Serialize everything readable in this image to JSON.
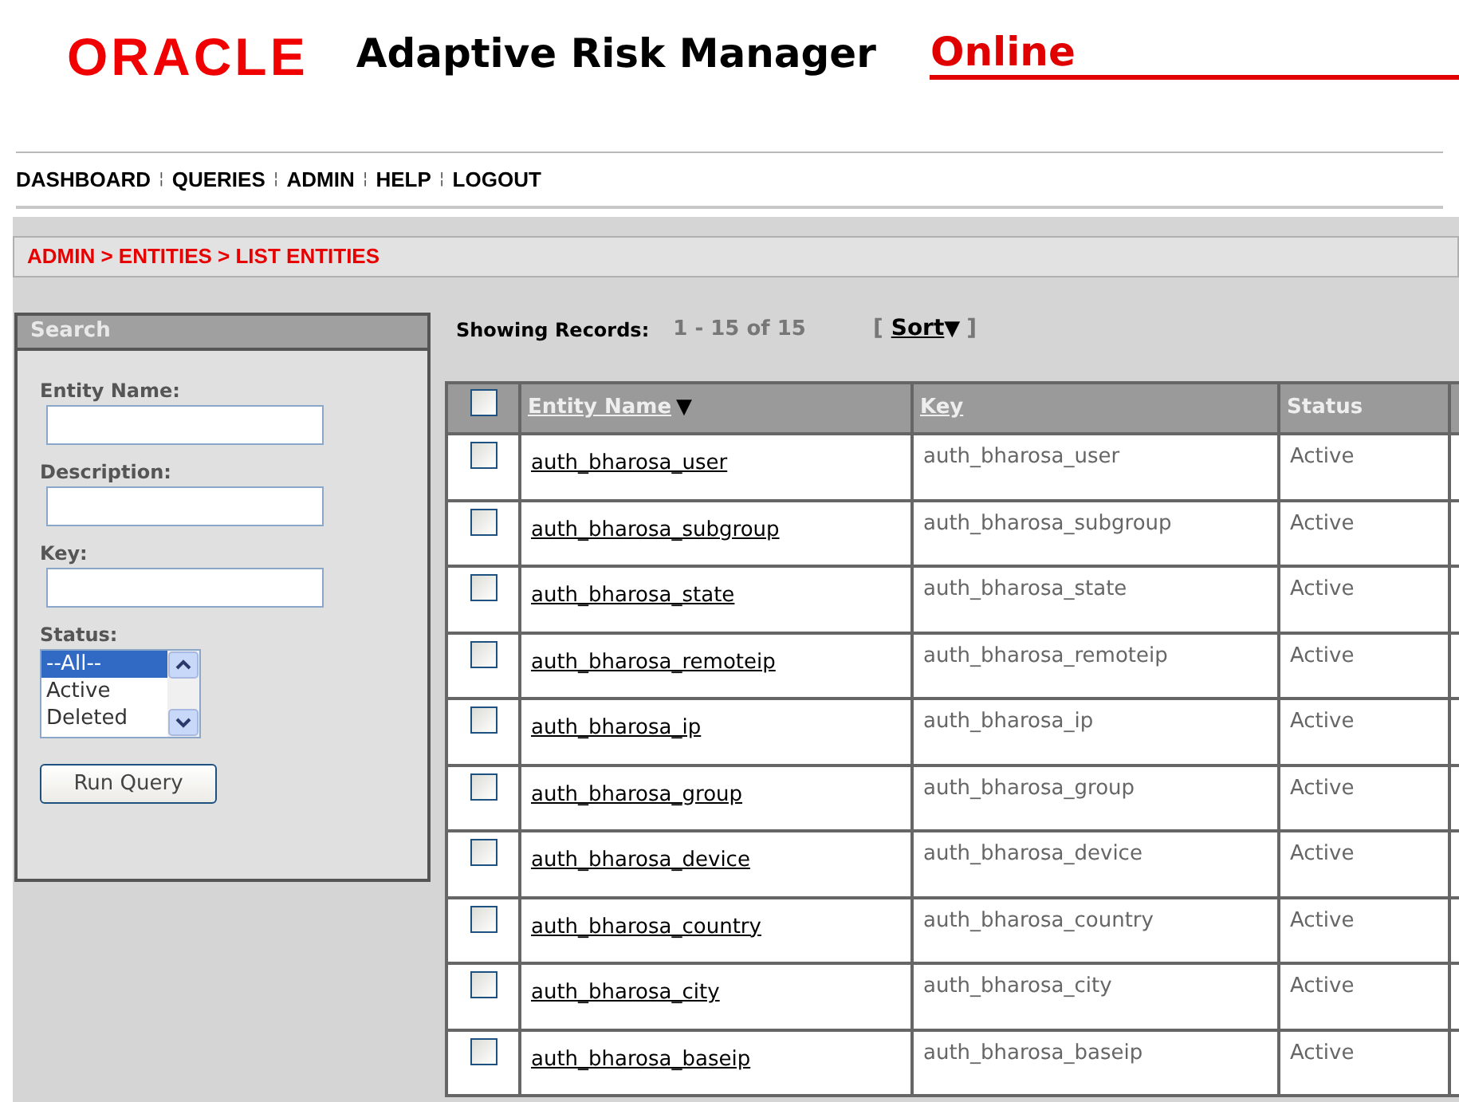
{
  "header": {
    "logo": "ORACLE",
    "product": "Adaptive Risk Manager",
    "edition": "Online"
  },
  "nav": [
    {
      "label": "DASHBOARD"
    },
    {
      "label": "QUERIES"
    },
    {
      "label": "ADMIN"
    },
    {
      "label": "HELP"
    },
    {
      "label": "LOGOUT"
    }
  ],
  "nav_separator": "¦",
  "breadcrumb": "ADMIN > ENTITIES > LIST ENTITIES",
  "search": {
    "title": "Search",
    "fields": [
      {
        "label": "Entity Name:"
      },
      {
        "label": "Description:"
      },
      {
        "label": "Key:"
      }
    ],
    "status_label": "Status:",
    "status_options": [
      {
        "label": "--All--",
        "selected": true
      },
      {
        "label": "Active",
        "selected": false
      },
      {
        "label": "Deleted",
        "selected": false
      }
    ],
    "run_button": "Run Query"
  },
  "records": {
    "label": "Showing Records:",
    "range": "1 - 15 of 15",
    "sort_open": "[",
    "sort": "Sort",
    "sort_arrow": "▼",
    "sort_close": "]"
  },
  "table": {
    "select_all": {
      "checked": false
    },
    "columns": [
      {
        "label": "Entity Name",
        "sort_arrow": "▼"
      },
      {
        "label": "Key"
      },
      {
        "label": "Status"
      }
    ],
    "rows": [
      {
        "checked": false,
        "name": "auth_bharosa_user",
        "key": "auth_bharosa_user",
        "status": "Active"
      },
      {
        "checked": false,
        "name": "auth_bharosa_subgroup",
        "key": "auth_bharosa_subgroup",
        "status": "Active"
      },
      {
        "checked": false,
        "name": "auth_bharosa_state",
        "key": "auth_bharosa_state",
        "status": "Active"
      },
      {
        "checked": false,
        "name": "auth_bharosa_remoteip",
        "key": "auth_bharosa_remoteip",
        "status": "Active"
      },
      {
        "checked": false,
        "name": "auth_bharosa_ip",
        "key": "auth_bharosa_ip",
        "status": "Active"
      },
      {
        "checked": false,
        "name": "auth_bharosa_group",
        "key": "auth_bharosa_group",
        "status": "Active"
      },
      {
        "checked": false,
        "name": "auth_bharosa_device",
        "key": "auth_bharosa_device",
        "status": "Active"
      },
      {
        "checked": false,
        "name": "auth_bharosa_country",
        "key": "auth_bharosa_country",
        "status": "Active"
      },
      {
        "checked": false,
        "name": "auth_bharosa_city",
        "key": "auth_bharosa_city",
        "status": "Active"
      },
      {
        "checked": false,
        "name": "auth_bharosa_baseip",
        "key": "auth_bharosa_baseip",
        "status": "Active"
      }
    ]
  }
}
